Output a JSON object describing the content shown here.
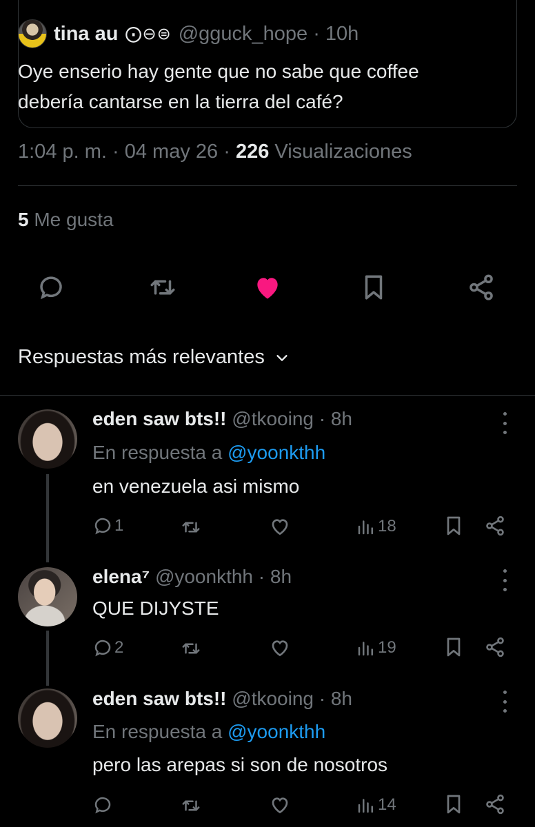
{
  "quote": {
    "name": "tina au",
    "badges": "⨀⊖⊜",
    "handle": "@gguck_hope · 10h",
    "text": "Oye enserio hay gente que no sabe que coffee debería cantarse en la tierra del café?"
  },
  "meta": {
    "time": "1:04 p. m.",
    "date": "· 04 may 26 ·",
    "views_count": "226",
    "views_label": "Visualizaciones"
  },
  "likes": {
    "count": "5",
    "label": "Me gusta"
  },
  "sort": {
    "label": "Respuestas más relevantes"
  },
  "colors": {
    "like_active": "#f91880",
    "mention": "#1d9bf0",
    "muted": "#71767b"
  },
  "replies": [
    {
      "name": "eden saw bts!!",
      "handle": "@tkooing · 8h",
      "reply_prefix": "En respuesta a",
      "reply_to": "@yoonkthh",
      "text": "en venezuela asi mismo",
      "comments": "1",
      "views": "18"
    },
    {
      "name": "elena⁷",
      "handle": "@yoonkthh · 8h",
      "text": "QUE DIJYSTE",
      "comments": "2",
      "views": "19"
    },
    {
      "name": "eden saw bts!!",
      "handle": "@tkooing · 8h",
      "reply_prefix": "En respuesta a",
      "reply_to": "@yoonkthh",
      "text": "pero las arepas si son de nosotros",
      "comments": "",
      "views": "14"
    }
  ]
}
